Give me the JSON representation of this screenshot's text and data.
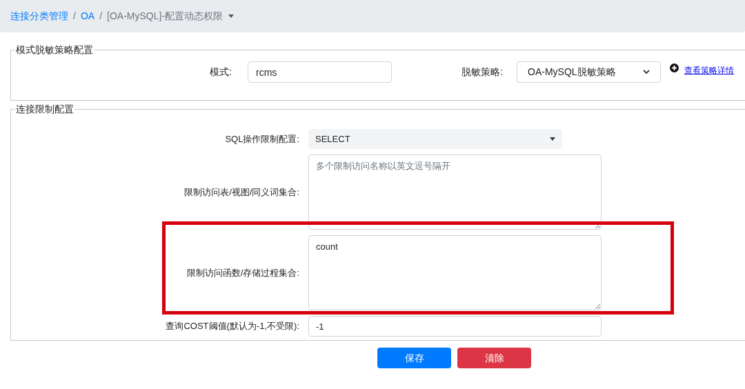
{
  "breadcrumb": [
    {
      "label": "连接分类管理",
      "kind": "link"
    },
    {
      "separator": "/",
      "label": "OA",
      "kind": "link"
    },
    {
      "separator": "/",
      "label": "[OA-MySQL]-配置动态权限",
      "kind": "dropdown"
    }
  ],
  "mask_section": {
    "legend": "模式脱敏策略配置",
    "mode_label": "模式:",
    "mode_value": "rcms",
    "policy_label": "脱敏策略:",
    "policy_value": "OA-MySQL脱敏策略",
    "detail_link": "查看策略详情"
  },
  "limit_section": {
    "legend": "连接限制配置",
    "fields": [
      {
        "kind": "select",
        "label": "SQL操作限制配置:",
        "value": "SELECT",
        "highlighted": false
      },
      {
        "kind": "textarea",
        "label": "限制访问表/视图/同义词集合:",
        "placeholder": "多个限制访问名称以英文逗号隔开",
        "highlighted": false
      },
      {
        "kind": "textarea",
        "label": "限制访问函数/存储过程集合:",
        "value": "count",
        "highlighted": true
      },
      {
        "kind": "input",
        "label": "查询COST阈值(默认为-1,不受限):",
        "value": "-1",
        "highlighted": false
      }
    ]
  },
  "buttons": [
    {
      "label": "保存",
      "kind": "primary"
    },
    {
      "label": "清除",
      "kind": "danger"
    }
  ]
}
